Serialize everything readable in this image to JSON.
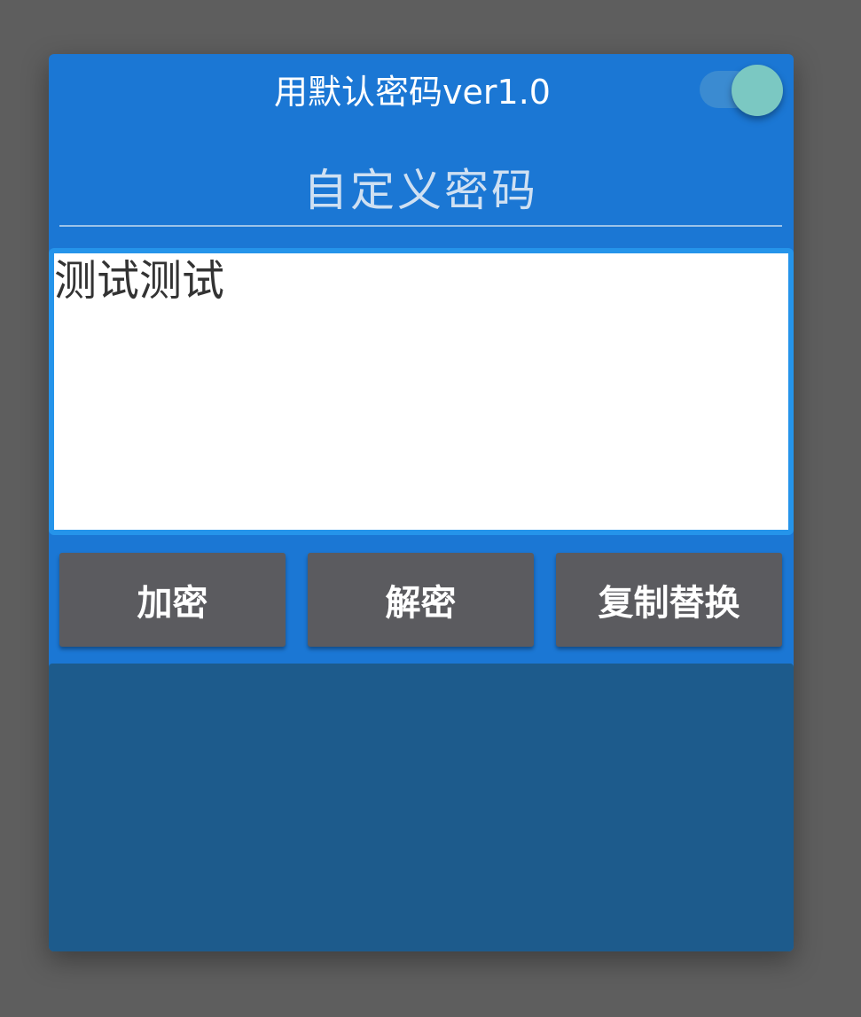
{
  "header": {
    "title": "用默认密码ver1.0",
    "toggle_on": true
  },
  "password": {
    "placeholder": "自定义密码",
    "value": ""
  },
  "text_input": {
    "value": "测试测试"
  },
  "buttons": {
    "encrypt": "加密",
    "decrypt": "解密",
    "copy_replace": "复制替换"
  },
  "result": {
    "text": ""
  },
  "colors": {
    "background": "#5e5e5e",
    "card": "#1b77d4",
    "toggle_knob": "#7bc8c2",
    "button": "#5b5b5f",
    "result_panel": "#1d5b8c"
  }
}
